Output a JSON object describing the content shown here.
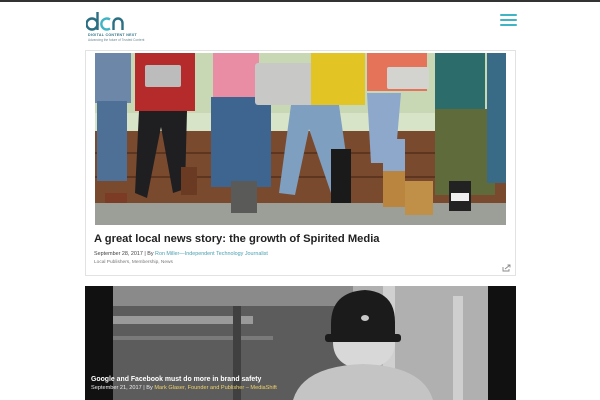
{
  "header": {
    "logo_mark": "dcn",
    "logo_line1": "DIGITAL CONTENT NEXT",
    "logo_line2": "Advancing the future of Trusted Content"
  },
  "colors": {
    "accent": "#3fb4c4",
    "logo_dark": "#2b6f83"
  },
  "icons": {
    "menu": "hamburger-menu-icon",
    "share": "share-icon"
  },
  "articles": [
    {
      "title": "A great local news story: the growth of Spirited Media",
      "date": "September 28, 2017",
      "by": " | By ",
      "author": "Ron Miller—Independent Technology Journalist",
      "tags": "Local Publishers, Membership, News"
    },
    {
      "title": "Google and Facebook must do more in brand safety",
      "date": "September 21, 2017",
      "by": " | By ",
      "author": "Mark Glaser, Founder and Publisher – MediaShift"
    }
  ]
}
